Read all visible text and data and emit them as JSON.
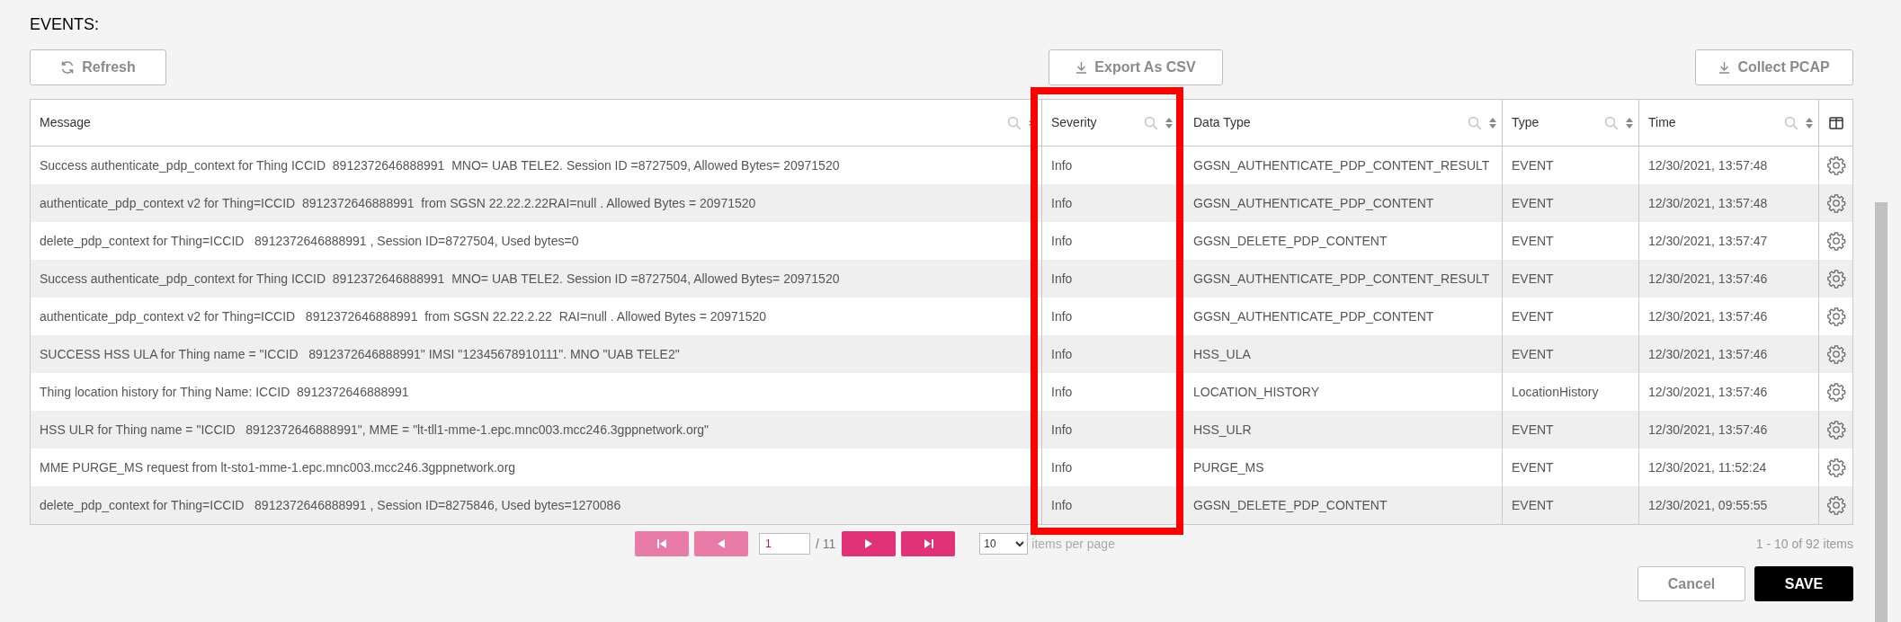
{
  "section_title": "EVENTS:",
  "toolbar": {
    "refresh": "Refresh",
    "export": "Export As CSV",
    "collect": "Collect PCAP"
  },
  "table": {
    "columns": [
      {
        "label": "Message",
        "highlighted": false
      },
      {
        "label": "Severity",
        "highlighted": true
      },
      {
        "label": "Data Type",
        "highlighted": false
      },
      {
        "label": "Type",
        "highlighted": false
      },
      {
        "label": "Time",
        "highlighted": false
      }
    ],
    "rows": [
      {
        "message": "Success authenticate_pdp_context for Thing ICCID  8912372646888991  MNO= UAB TELE2. Session ID =8727509, Allowed Bytes= 20971520",
        "severity": "Info",
        "data_type": "GGSN_AUTHENTICATE_PDP_CONTENT_RESULT",
        "type": "EVENT",
        "time": "12/30/2021, 13:57:48"
      },
      {
        "message": "authenticate_pdp_context v2 for Thing=ICCID  8912372646888991  from SGSN 22.22.2.22RAI=null . Allowed Bytes = 20971520",
        "severity": "Info",
        "data_type": "GGSN_AUTHENTICATE_PDP_CONTENT",
        "type": "EVENT",
        "time": "12/30/2021, 13:57:48"
      },
      {
        "message": "delete_pdp_context for Thing=ICCID   8912372646888991 , Session ID=8727504, Used bytes=0",
        "severity": "Info",
        "data_type": "GGSN_DELETE_PDP_CONTENT",
        "type": "EVENT",
        "time": "12/30/2021, 13:57:47"
      },
      {
        "message": "Success authenticate_pdp_context for Thing ICCID  8912372646888991  MNO= UAB TELE2. Session ID =8727504, Allowed Bytes= 20971520",
        "severity": "Info",
        "data_type": "GGSN_AUTHENTICATE_PDP_CONTENT_RESULT",
        "type": "EVENT",
        "time": "12/30/2021, 13:57:46"
      },
      {
        "message": "authenticate_pdp_context v2 for Thing=ICCID   8912372646888991  from SGSN 22.22.2.22  RAI=null . Allowed Bytes = 20971520",
        "severity": "Info",
        "data_type": "GGSN_AUTHENTICATE_PDP_CONTENT",
        "type": "EVENT",
        "time": "12/30/2021, 13:57:46"
      },
      {
        "message": "SUCCESS HSS ULA for Thing name = \"ICCID   8912372646888991\" IMSI \"12345678910111\". MNO \"UAB TELE2\"",
        "severity": "Info",
        "data_type": "HSS_ULA",
        "type": "EVENT",
        "time": "12/30/2021, 13:57:46"
      },
      {
        "message": "Thing location history for Thing Name: ICCID  8912372646888991",
        "severity": "Info",
        "data_type": "LOCATION_HISTORY",
        "type": "LocationHistory",
        "time": "12/30/2021, 13:57:46"
      },
      {
        "message": "HSS ULR for Thing name = \"ICCID   8912372646888991\", MME = \"lt-tll1-mme-1.epc.mnc003.mcc246.3gppnetwork.org\"",
        "severity": "Info",
        "data_type": "HSS_ULR",
        "type": "EVENT",
        "time": "12/30/2021, 13:57:46"
      },
      {
        "message": "MME PURGE_MS request from lt-sto1-mme-1.epc.mnc003.mcc246.3gppnetwork.org",
        "severity": "Info",
        "data_type": "PURGE_MS",
        "type": "EVENT",
        "time": "12/30/2021, 11:52:24"
      },
      {
        "message": "delete_pdp_context for Thing=ICCID   8912372646888991 , Session ID=8275846, Used bytes=1270086",
        "severity": "Info",
        "data_type": "GGSN_DELETE_PDP_CONTENT",
        "type": "EVENT",
        "time": "12/30/2021, 09:55:55"
      }
    ]
  },
  "pagination": {
    "page": "1",
    "total": "/ 11",
    "per_page": "10",
    "per_page_label": "items per page",
    "summary": "1 - 10 of 92 items"
  },
  "actions": {
    "cancel": "Cancel",
    "save": "SAVE"
  }
}
